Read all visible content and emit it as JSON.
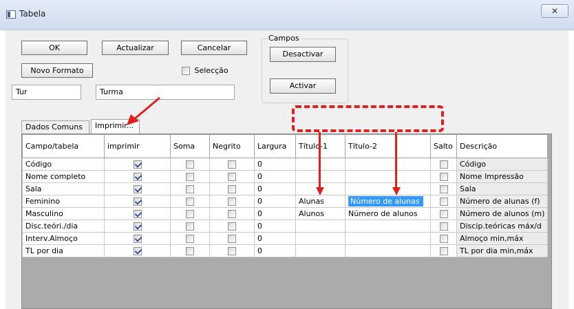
{
  "window": {
    "title": "Tabela",
    "close_glyph": "✕"
  },
  "buttons": {
    "ok": "OK",
    "actualizar": "Actualizar",
    "cancelar": "Cancelar",
    "novo_formato": "Novo Formato",
    "desactivar": "Desactivar",
    "activar": "Activar"
  },
  "seleccao": {
    "label": "Selecção",
    "checked": false
  },
  "campos_group": {
    "title": "Campos"
  },
  "fields": {
    "code": "Tur",
    "name": "Turma"
  },
  "tabs": [
    {
      "label": "Dados Comuns",
      "active": false
    },
    {
      "label": "Imprimir...",
      "active": true
    }
  ],
  "grid": {
    "columns": [
      "Campo/tabela",
      "imprimir",
      "Soma",
      "Negrito",
      "Largura",
      "Título-1",
      "Título-2",
      "Salto",
      "Descrição"
    ],
    "rows": [
      {
        "campo": "Código",
        "imprimir": true,
        "soma": false,
        "negrito": false,
        "largura": "0",
        "titulo1": "",
        "titulo2": "",
        "salto": false,
        "descricao": "Código"
      },
      {
        "campo": "Nome completo",
        "imprimir": true,
        "soma": false,
        "negrito": false,
        "largura": "0",
        "titulo1": "",
        "titulo2": "",
        "salto": false,
        "descricao": "Nome Impressão"
      },
      {
        "campo": "Sala",
        "imprimir": true,
        "soma": false,
        "negrito": false,
        "largura": "0",
        "titulo1": "",
        "titulo2": "",
        "salto": false,
        "descricao": "Sala"
      },
      {
        "campo": "Feminino",
        "imprimir": true,
        "soma": false,
        "negrito": false,
        "largura": "0",
        "titulo1": "Alunas",
        "titulo2": "Número de alunas",
        "salto": false,
        "descricao": "Número de alunas (f)",
        "selected_cell": "titulo2"
      },
      {
        "campo": "Masculino",
        "imprimir": true,
        "soma": false,
        "negrito": false,
        "largura": "0",
        "titulo1": "Alunos",
        "titulo2": "Número de alunos",
        "salto": false,
        "descricao": "Número de alunos (m)"
      },
      {
        "campo": "Disc.teóri./dia",
        "imprimir": true,
        "soma": false,
        "negrito": false,
        "largura": "0",
        "titulo1": "",
        "titulo2": "",
        "salto": false,
        "descricao": "Discip.teóricas máx/d"
      },
      {
        "campo": "Interv.Almoço",
        "imprimir": true,
        "soma": false,
        "negrito": false,
        "largura": "0",
        "titulo1": "",
        "titulo2": "",
        "salto": false,
        "descricao": "Almoço min,máx"
      },
      {
        "campo": "TL por dia",
        "imprimir": true,
        "soma": false,
        "negrito": false,
        "largura": "0",
        "titulo1": "",
        "titulo2": "",
        "salto": false,
        "descricao": "TL por dia min,máx"
      }
    ]
  },
  "colors": {
    "annotation": "#e02020",
    "selection": "#3399ff"
  }
}
